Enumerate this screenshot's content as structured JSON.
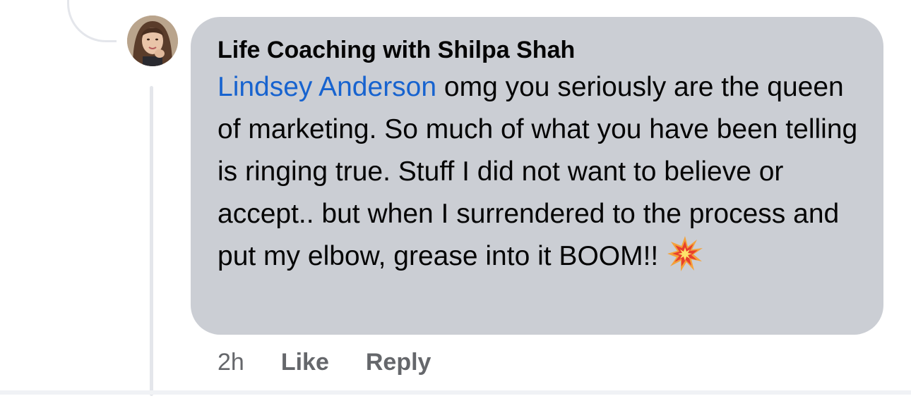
{
  "comment": {
    "author": "Life Coaching with Shilpa Shah",
    "mention": "Lindsey Anderson",
    "text": " omg you seriously are the queen of marketing. So much of what you have been telling is ringing true. Stuff I did not want to believe or accept.. but when I surrendered to the process and put my elbow, grease into it  BOOM!!",
    "emoji": "collision-emoji",
    "timestamp": "2h",
    "like_label": "Like",
    "reply_label": "Reply"
  },
  "colors": {
    "bubble": "#cbced4",
    "mention": "#1763cf",
    "meta_text": "#65676b",
    "thread_line": "#e4e6eb"
  }
}
